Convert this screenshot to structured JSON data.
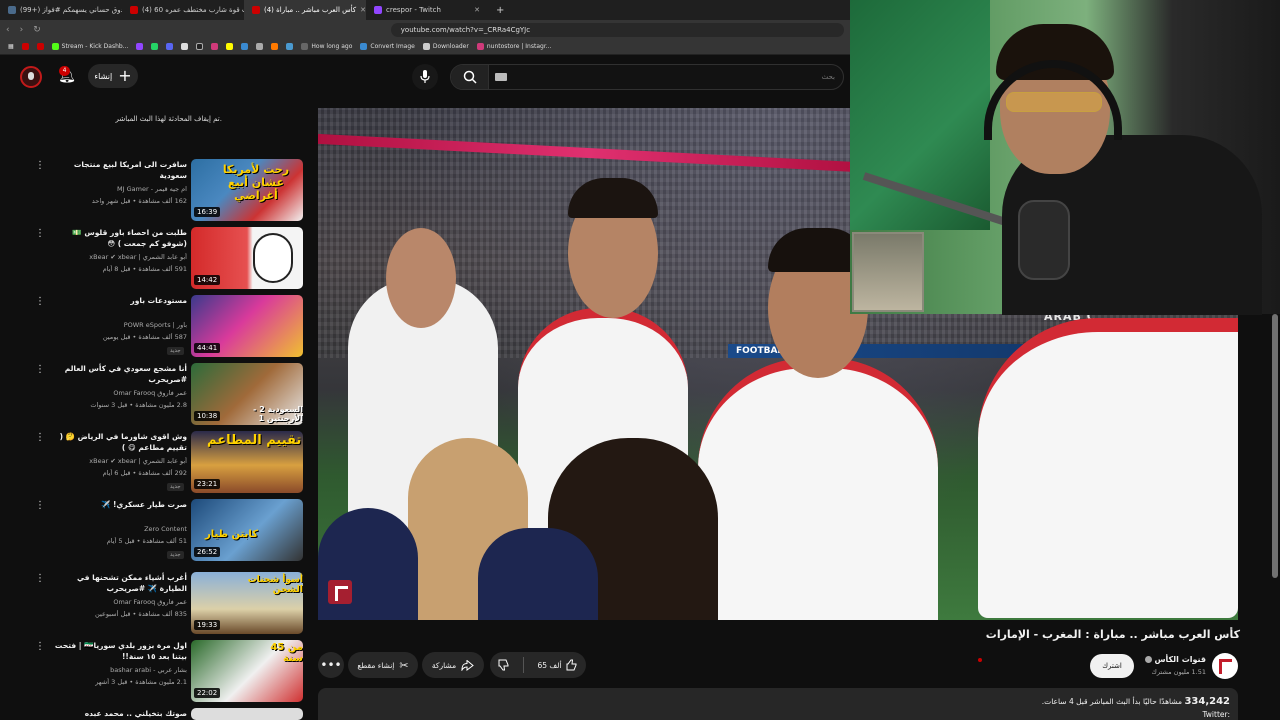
{
  "browser": {
    "tabs": [
      {
        "label": "(99+) صندوق حساني يسهمكم #فواز",
        "color": "#4a6a8a"
      },
      {
        "label": "(4) اختبرت قوة شارب مختطف عمره 60",
        "color": "#cc0000"
      },
      {
        "label": "(4) كأس العرب مباشر .. مباراة",
        "color": "#cc0000"
      },
      {
        "label": "crespor - Twitch",
        "color": "#9146ff"
      }
    ],
    "new_tab_glyph": "+",
    "url": "youtube.com/watch?v=_CRRa4CgYJc",
    "bookmarks": [
      {
        "label": "Stream - Kick Dashb...",
        "color": "#53fc18"
      },
      {
        "label": "How long ago",
        "color": "#666666"
      },
      {
        "label": "Convert Image",
        "color": "#3a8ad0"
      },
      {
        "label": "Downloader",
        "color": "#cccccc"
      },
      {
        "label": "nuntostore | Instagr...",
        "color": "#d03a7a"
      }
    ]
  },
  "header": {
    "notification_count": "4",
    "create_label": "إنشاء",
    "search_placeholder": "بحث"
  },
  "sidebar": {
    "chat_notice": "تم إيقاف المحادثة لهذا البث المباشر.",
    "recommendations": [
      {
        "title": "سافرت الى امريكا لبيع منتجات سعودية",
        "channel": "ام جيه قيمر - MJ Gamer",
        "meta": "162 ألف مشاهدة • قبل شهر واحد",
        "duration": "16:39",
        "thumb_text": "رحت لأمريكا عشان أبيع أغراضي",
        "new": ""
      },
      {
        "title": "طلبت من احصاء باور قلوس 💵 (شوفو كم جمعت ) 😳",
        "channel": "أبو عابد الشمري | xBear ✔ xbear",
        "meta": "591 ألف مشاهدة • قبل 8 أيام",
        "duration": "14:42",
        "thumb_text": "",
        "new": ""
      },
      {
        "title": "مستودعات باور",
        "channel": "باور | POWR eSports",
        "meta": "587 ألف مشاهدة • قبل يومين",
        "duration": "44:41",
        "thumb_text": "",
        "new": "جديد"
      },
      {
        "title": "أنا مشجع سعودي في كأس العالم #صريحرب",
        "channel": "عمر فاروق Omar Farooq",
        "meta": "2.8 مليون مشاهدة • قبل 3 سنوات",
        "duration": "10:38",
        "thumb_text": "السعودية 2 - الأرجنتين 1",
        "new": ""
      },
      {
        "title": "وش اقوى شاورما في الرياض 🤔 ( تقييم مطاعم 😋 )",
        "channel": "أبو عابد الشمري | xBear ✔ xbear",
        "meta": "292 ألف مشاهدة • قبل 6 أيام",
        "duration": "23:21",
        "thumb_text": "تقييم المطاعم",
        "new": "جديد"
      },
      {
        "title": "صرت طيار عسكري! ✈️",
        "channel": "Zero Content",
        "meta": "51 ألف مشاهدة • قبل 5 أيام",
        "duration": "26:52",
        "thumb_text": "كابتن طيار",
        "new": "جديد"
      },
      {
        "title": "أغرب أشياء ممكن تشحنها في الطيارة ✈️ #صريحرب",
        "channel": "عمر فاروق Omar Farooq",
        "meta": "835 ألف مشاهدة • قبل أسبوعين",
        "duration": "19:33",
        "thumb_text": "أسوأ شحنات الشحن",
        "new": ""
      },
      {
        "title": "اول مرة بزور بلدي سوريا🇸🇾 | فتحت بيتنا بعد ١٥ سنة!!",
        "channel": "بشار عربي - bashar arabi",
        "meta": "2.1 مليون مشاهدة • قبل 3 أشهر",
        "duration": "22:02",
        "thumb_text": "من 45 سنة",
        "new": ""
      }
    ],
    "partial_title": "صوتك بتخيلني .. محمد عبده"
  },
  "player": {
    "board_text": "ARAB C",
    "board_text2": "FOOTBALL"
  },
  "video": {
    "title": "كأس العرب مباشر .. مباراة : المغرب - الإمارات",
    "channel_name": "قنوات الكأس",
    "subscribers": "1.51 مليون مشترك",
    "subscribe_label": "اشترك",
    "likes": "65 ألف",
    "share_label": "مشاركة",
    "clip_label": "إنشاء مقطع",
    "more_glyph": "•••",
    "viewers_count": "334,242",
    "viewers_text": "مشاهدًا حاليًا  بدأ البث المباشر قبل 4 ساعات.",
    "twitter_label": "Twitter:"
  },
  "colors": {
    "background": "#0f0f0f",
    "accent_red": "#cc0000",
    "pill": "#272727"
  }
}
